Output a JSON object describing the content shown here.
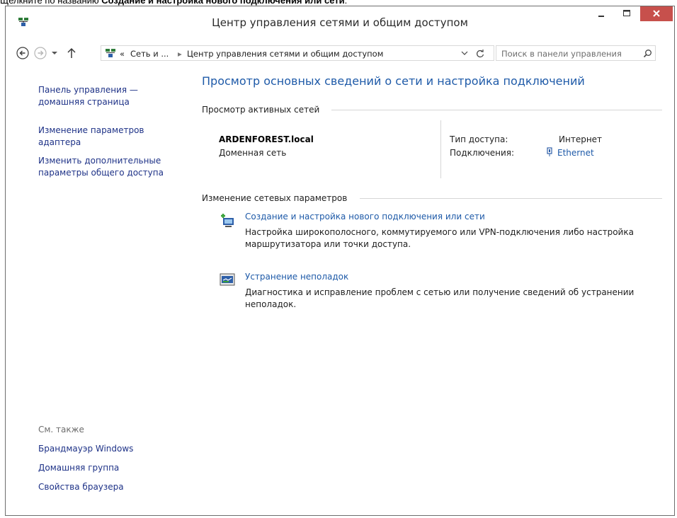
{
  "instruction": {
    "prefix": "Щелкните по названию",
    "bold": "Создание и настройка нового подключения или сети",
    "suffix": "."
  },
  "window": {
    "title": "Центр управления сетями и общим доступом",
    "close_color": "#c7504c"
  },
  "address": {
    "chevron": "«",
    "crumb_1": "Сеть и ...",
    "separator": "▸",
    "crumb_2": "Центр управления сетями и общим доступом",
    "search_placeholder": "Поиск в панели управления"
  },
  "sidebar": {
    "home_link": [
      "Панель управления —",
      "домашняя страница"
    ],
    "adapter_link": [
      "Изменение параметров",
      "адаптера"
    ],
    "sharing_link": [
      "Изменить дополнительные",
      "параметры общего доступа"
    ],
    "see_also": "См. также",
    "firewall": "Брандмауэр Windows",
    "homegroup": "Домашняя группа",
    "browser_props": "Свойства браузера"
  },
  "main": {
    "heading": "Просмотр основных сведений о сети и настройка подключений",
    "active_networks": "Просмотр активных сетей",
    "network_name": "ARDENFOREST.local",
    "network_type": "Доменная сеть",
    "access_label": "Тип доступа:",
    "access_value": "Интернет",
    "connections_label": "Подключения:",
    "connections_value": "Ethernet",
    "change_settings": "Изменение сетевых параметров",
    "task_1": {
      "title": "Создание и настройка нового подключения или сети",
      "desc": [
        "Настройка широкополосного, коммутируемого или VPN-подключения либо настройка",
        "маршрутизатора или точки доступа."
      ]
    },
    "task_2": {
      "title": "Устранение неполадок",
      "desc": [
        "Диагностика и исправление проблем с сетью или получение сведений об устранении",
        "неполадок."
      ]
    }
  },
  "colors": {
    "link": "#1e5aa8",
    "sidebar_link": "#1e3287"
  }
}
